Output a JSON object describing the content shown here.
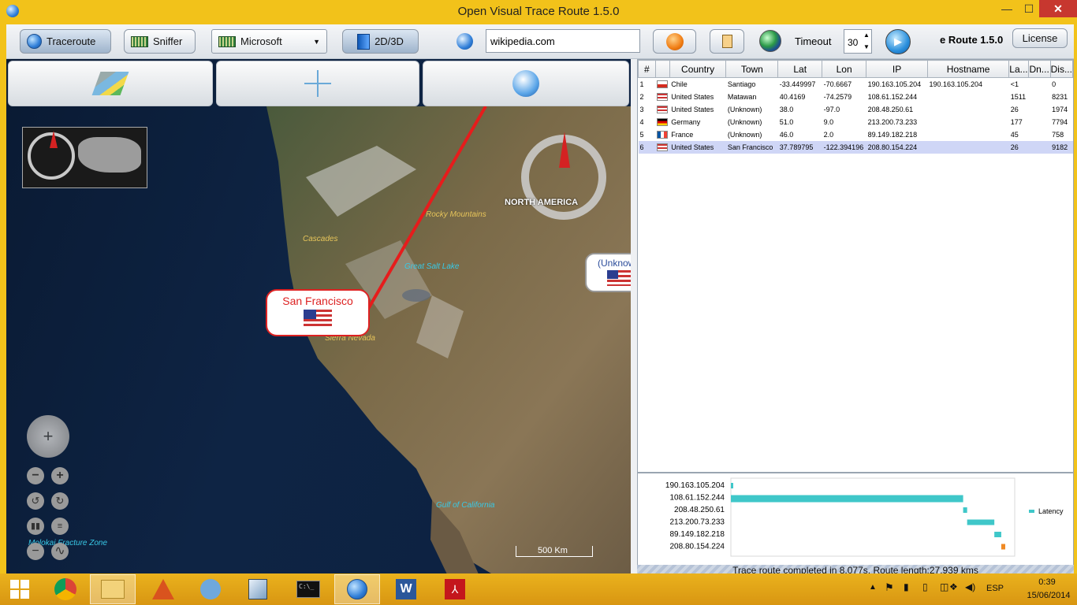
{
  "window": {
    "title": "Open Visual Trace Route 1.5.0",
    "min": "—",
    "max": "☐",
    "close": "✕"
  },
  "toolbar": {
    "traceroute": "Traceroute",
    "sniffer": "Sniffer",
    "interface": "Microsoft",
    "view": "2D/3D",
    "host": "wikipedia.com",
    "timeout_label": "Timeout",
    "timeout_value": "30",
    "app_version": "e Route 1.5.0",
    "license": "License"
  },
  "map": {
    "labels": {
      "north_america": "NORTH AMERICA",
      "rocky": "Rocky Mountains",
      "cascades": "Cascades",
      "salt_lake": "Great Salt Lake",
      "sierra": "Sierra Nevada",
      "gulf": "Gulf of California",
      "molokai": "Molokai Fracture Zone"
    },
    "callout_main": "San Francisco",
    "callout_side": "(Unknow",
    "scale": "500 Km"
  },
  "table": {
    "headers": [
      "#",
      "",
      "Country",
      "Town",
      "Lat",
      "Lon",
      "IP",
      "Hostname",
      "La...",
      "Dn...",
      "Dis..."
    ],
    "rows": [
      {
        "n": "1",
        "flag": "cl",
        "country": "Chile",
        "town": "Santiago",
        "lat": "-33.449997",
        "lon": "-70.6667",
        "ip": "190.163.105.204",
        "host": "190.163.105.204",
        "lat_ms": "<1",
        "dns": "",
        "dist": "0"
      },
      {
        "n": "2",
        "flag": "us",
        "country": "United States",
        "town": "Matawan",
        "lat": "40.4169",
        "lon": "-74.2579",
        "ip": "108.61.152.244",
        "host": "",
        "lat_ms": "1511",
        "dns": "",
        "dist": "8231"
      },
      {
        "n": "3",
        "flag": "us",
        "country": "United States",
        "town": "(Unknown)",
        "lat": "38.0",
        "lon": "-97.0",
        "ip": "208.48.250.61",
        "host": "",
        "lat_ms": "26",
        "dns": "",
        "dist": "1974"
      },
      {
        "n": "4",
        "flag": "de",
        "country": "Germany",
        "town": "(Unknown)",
        "lat": "51.0",
        "lon": "9.0",
        "ip": "213.200.73.233",
        "host": "",
        "lat_ms": "177",
        "dns": "",
        "dist": "7794"
      },
      {
        "n": "5",
        "flag": "fr",
        "country": "France",
        "town": "(Unknown)",
        "lat": "46.0",
        "lon": "2.0",
        "ip": "89.149.182.218",
        "host": "",
        "lat_ms": "45",
        "dns": "",
        "dist": "758"
      },
      {
        "n": "6",
        "flag": "us",
        "country": "United States",
        "town": "San Francisco",
        "lat": "37.789795",
        "lon": "-122.394196",
        "ip": "208.80.154.224",
        "host": "",
        "lat_ms": "26",
        "dns": "",
        "dist": "9182"
      }
    ]
  },
  "latency_chart": {
    "legend": "Latency",
    "color": "#3fc7c9",
    "last_color": "#f08a24",
    "chart_data": {
      "type": "bar",
      "categories": [
        "190.163.105.204",
        "108.61.152.244",
        "208.48.250.61",
        "213.200.73.233",
        "89.149.182.218",
        "208.80.154.224"
      ],
      "series": [
        {
          "name": "Latency",
          "values": [
            0,
            1511,
            26,
            177,
            45,
            26
          ]
        }
      ]
    }
  },
  "status": "Trace route completed in 8,077s. Route length:27,939 kms",
  "taskbar": {
    "lang": "ESP",
    "time": "0:39",
    "date": "15/06/2014"
  }
}
